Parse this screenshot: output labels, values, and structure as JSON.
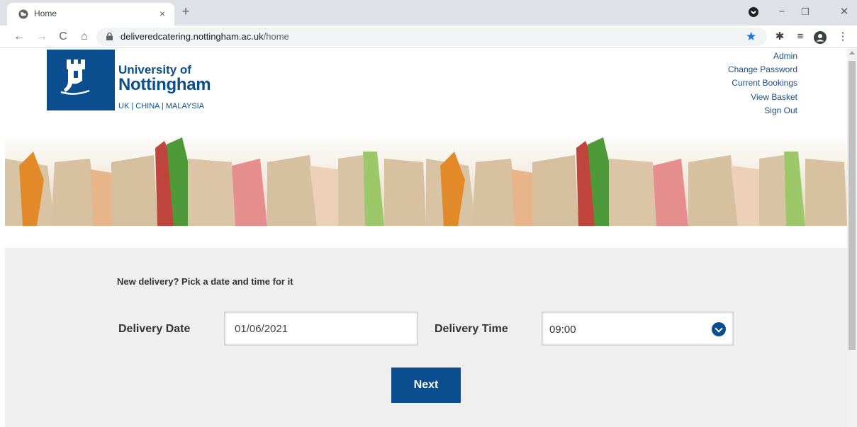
{
  "browser": {
    "tab_title": "Home",
    "tab_close": "×",
    "new_tab": "+",
    "url_host": "deliveredcatering.nottingham.ac.uk",
    "url_path": "/home",
    "window_controls": {
      "minimize": "−",
      "restore": "❐",
      "close": "✕"
    },
    "nav": {
      "back": "←",
      "forward": "→",
      "reload": "C",
      "home": "⌂"
    },
    "toolbar_icons": {
      "star": "★",
      "extensions": "✱",
      "media": "≡",
      "profile": "●",
      "menu": "⋮"
    }
  },
  "header": {
    "logo_line1": "University of",
    "logo_line2": "Nottingham",
    "logo_tagline": "UK | CHINA | MALAYSIA",
    "links": [
      "Admin",
      "Change Password",
      "Current Bookings",
      "View Basket",
      "Sign Out"
    ]
  },
  "form": {
    "prompt": "New delivery? Pick a date and time for it",
    "date_label": "Delivery Date",
    "date_value": "01/06/2021",
    "time_label": "Delivery Time",
    "time_value": "09:00",
    "next_label": "Next"
  },
  "colors": {
    "brand": "#0b4e8f",
    "link": "#1e4e8c",
    "form_bg": "#efefef"
  }
}
